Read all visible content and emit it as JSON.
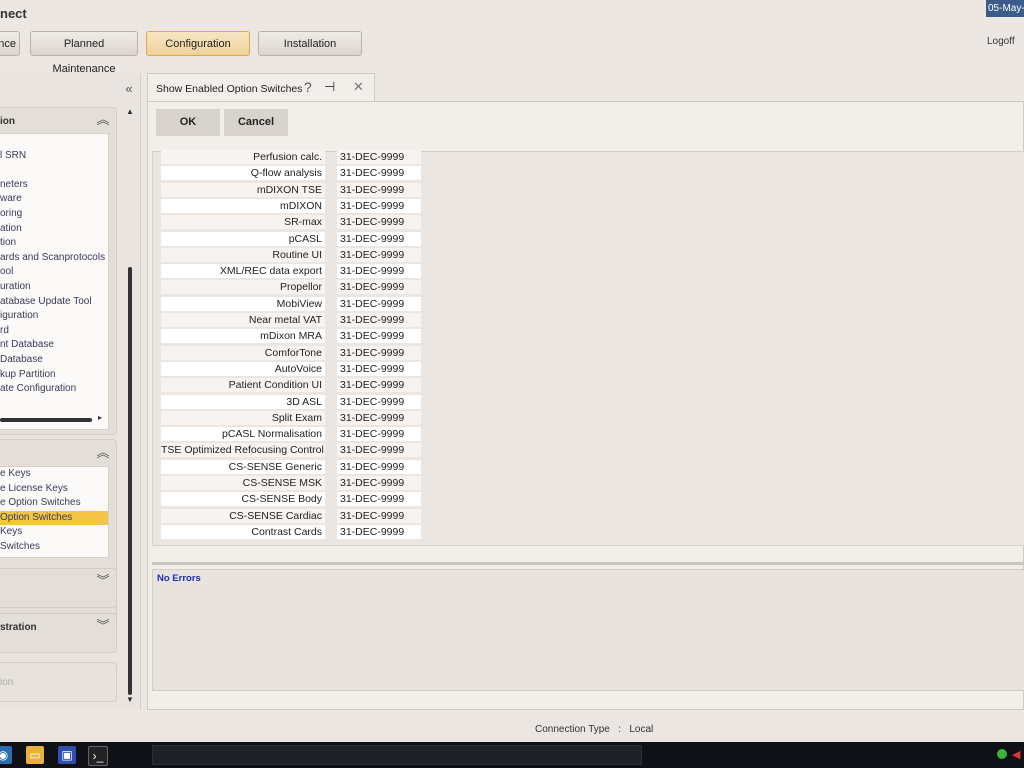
{
  "app": {
    "title": "nect",
    "date": "05-May-2"
  },
  "header": {
    "tabs": [
      {
        "label": "nce"
      },
      {
        "label": "Planned Maintenance"
      },
      {
        "label": "Configuration"
      },
      {
        "label": "Installation"
      }
    ],
    "logoff": "Logoff"
  },
  "left_panel": {
    "group1": {
      "title": "ion",
      "items": [
        "",
        "l SRN",
        "",
        "neters",
        "ware",
        "oring",
        "ation",
        "tion",
        "ards and Scanprotocols",
        "ool",
        "uration",
        "atabase Update Tool",
        "iguration",
        "rd",
        "nt Database",
        "Database",
        "kup Partition",
        "ate Configuration"
      ]
    },
    "group2": {
      "items": [
        "e Keys",
        "e License Keys",
        "e Option Switches",
        "Option Switches",
        "Keys",
        "Switches"
      ],
      "selected_index": 3
    },
    "group3": {
      "title": ""
    },
    "group4": {
      "title": "stration"
    },
    "group5": {
      "title": "ion"
    }
  },
  "main": {
    "tab_label": "Show Enabled Option Switches",
    "ok_label": "OK",
    "cancel_label": "Cancel",
    "options": [
      {
        "name": "Perfusion calc.",
        "date": "31-DEC-9999"
      },
      {
        "name": "Q-flow analysis",
        "date": "31-DEC-9999"
      },
      {
        "name": "mDIXON TSE",
        "date": "31-DEC-9999"
      },
      {
        "name": "mDIXON",
        "date": "31-DEC-9999"
      },
      {
        "name": "SR-max",
        "date": "31-DEC-9999"
      },
      {
        "name": "pCASL",
        "date": "31-DEC-9999"
      },
      {
        "name": "Routine UI",
        "date": "31-DEC-9999"
      },
      {
        "name": "XML/REC data export",
        "date": "31-DEC-9999"
      },
      {
        "name": "Propellor",
        "date": "31-DEC-9999"
      },
      {
        "name": "MobiView",
        "date": "31-DEC-9999"
      },
      {
        "name": "Near metal VAT",
        "date": "31-DEC-9999"
      },
      {
        "name": "mDixon MRA",
        "date": "31-DEC-9999"
      },
      {
        "name": "ComforTone",
        "date": "31-DEC-9999"
      },
      {
        "name": "AutoVoice",
        "date": "31-DEC-9999"
      },
      {
        "name": "Patient Condition UI",
        "date": "31-DEC-9999"
      },
      {
        "name": "3D ASL",
        "date": "31-DEC-9999"
      },
      {
        "name": "Split Exam",
        "date": "31-DEC-9999"
      },
      {
        "name": "pCASL Normalisation",
        "date": "31-DEC-9999"
      },
      {
        "name": "TSE Optimized Refocusing Control",
        "date": "31-DEC-9999"
      },
      {
        "name": "CS-SENSE Generic",
        "date": "31-DEC-9999"
      },
      {
        "name": "CS-SENSE MSK",
        "date": "31-DEC-9999"
      },
      {
        "name": "CS-SENSE Body",
        "date": "31-DEC-9999"
      },
      {
        "name": "CS-SENSE Cardiac",
        "date": "31-DEC-9999"
      },
      {
        "name": "Contrast Cards",
        "date": "31-DEC-9999"
      }
    ],
    "message": "No Errors"
  },
  "status": {
    "connection_label": "Connection Type",
    "separator": ":",
    "connection_value": "Local"
  },
  "colors": {
    "accent": "#f3c547",
    "message": "#1d2fb5"
  }
}
